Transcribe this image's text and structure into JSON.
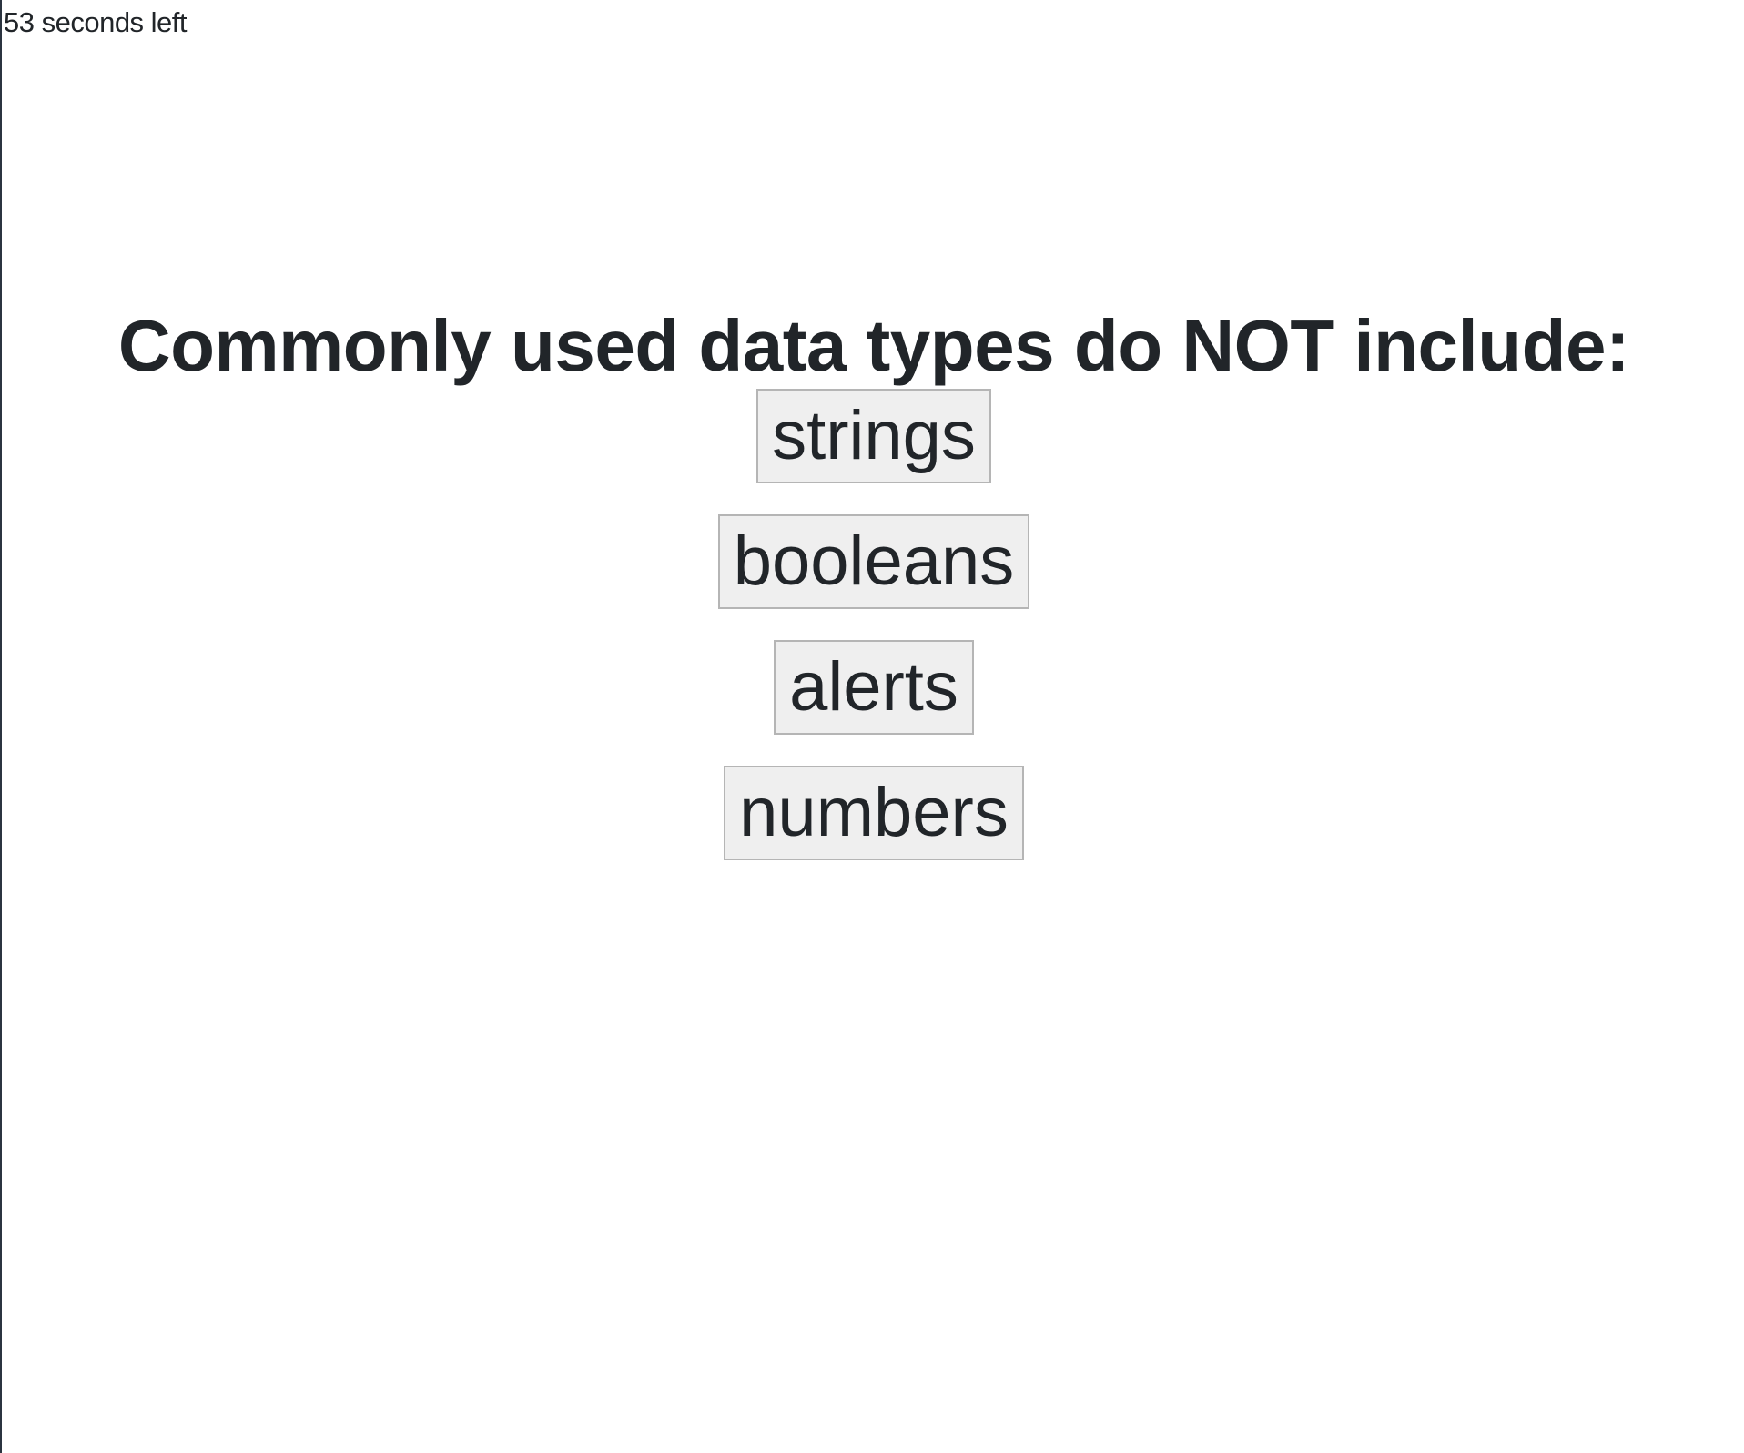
{
  "timer": {
    "text": "53 seconds left"
  },
  "quiz": {
    "question": "Commonly used data types do NOT include:",
    "answers": [
      "strings",
      "booleans",
      "alerts",
      "numbers"
    ]
  }
}
